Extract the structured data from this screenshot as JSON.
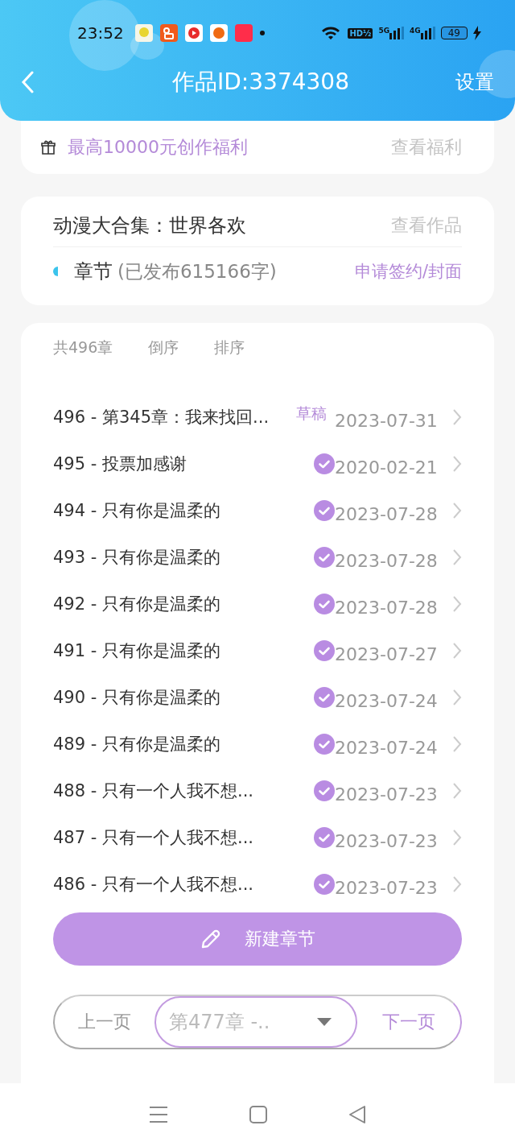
{
  "status_bar": {
    "time": "23:52",
    "hd": "HD½",
    "networks": [
      "5G",
      "4G"
    ],
    "battery": "49"
  },
  "header": {
    "title": "作品ID:3374308",
    "settings": "设置"
  },
  "benefit": {
    "text": "最高10000元创作福利",
    "link": "查看福利"
  },
  "work": {
    "title": "动漫大合集：世界各欢",
    "link": "查看作品",
    "section": "章节",
    "count": "(已发布615166字)",
    "apply": "申请签约/封面"
  },
  "chapters": {
    "total": "共496章",
    "reverse": "倒序",
    "sort": "排序",
    "items": [
      {
        "title": "496 - 第345章：我来找回...",
        "draft": true,
        "badge": "草稿",
        "date": "2023-07-31"
      },
      {
        "title": "495 - 投票加感谢",
        "draft": false,
        "date": "2020-02-21"
      },
      {
        "title": "494 - 只有你是温柔的",
        "draft": false,
        "date": "2023-07-28"
      },
      {
        "title": "493 - 只有你是温柔的",
        "draft": false,
        "date": "2023-07-28"
      },
      {
        "title": "492 - 只有你是温柔的",
        "draft": false,
        "date": "2023-07-28"
      },
      {
        "title": "491 - 只有你是温柔的",
        "draft": false,
        "date": "2023-07-27"
      },
      {
        "title": "490 - 只有你是温柔的",
        "draft": false,
        "date": "2023-07-24"
      },
      {
        "title": "489 - 只有你是温柔的",
        "draft": false,
        "date": "2023-07-24"
      },
      {
        "title": "488 - 只有一个人我不想...",
        "draft": false,
        "date": "2023-07-23"
      },
      {
        "title": "487 - 只有一个人我不想...",
        "draft": false,
        "date": "2023-07-23"
      },
      {
        "title": "486 - 只有一个人我不想...",
        "draft": false,
        "date": "2023-07-23"
      }
    ],
    "new_button": "新建章节"
  },
  "pager": {
    "prev": "上一页",
    "select": "第477章 -..",
    "next": "下一页"
  }
}
